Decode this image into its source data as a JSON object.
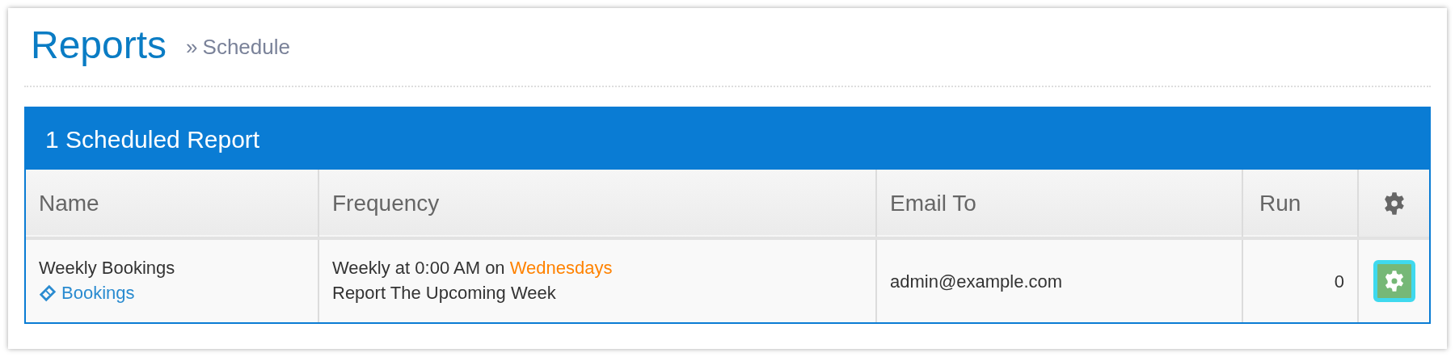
{
  "page": {
    "title": "Reports",
    "breadcrumb_separator": "»",
    "breadcrumb": "Schedule"
  },
  "panel": {
    "title": "1 Scheduled Report"
  },
  "table": {
    "columns": [
      "Name",
      "Frequency",
      "Email To",
      "Run"
    ],
    "rows": [
      {
        "name": "Weekly Bookings",
        "report_link": "Bookings",
        "frequency": "Weekly at 0:00 AM on ",
        "frequency_day": "Wednesdays",
        "frequency_note": "Report The Upcoming Week",
        "email_to": "admin@example.com",
        "run": "0",
        "settings_focused": true
      }
    ]
  }
}
